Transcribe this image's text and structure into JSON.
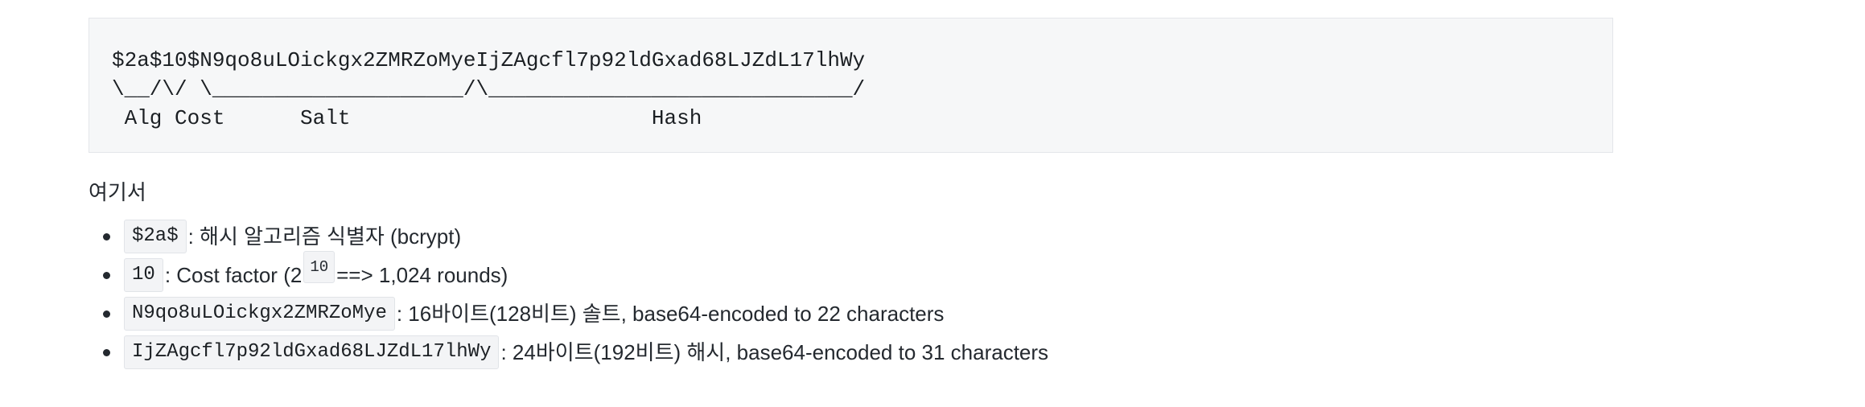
{
  "code_block": {
    "line1": "$2a$10$N9qo8uLOickgx2ZMRZoMyeIjZAgcfl7p92ldGxad68LJZdL17lhWy",
    "line2": "\\__/\\/ \\____________________/\\_____________________________/",
    "line3": " Alg Cost      Salt                        Hash"
  },
  "intro": "여기서",
  "items": [
    {
      "code": "$2a$",
      "text": ": 해시 알고리즘 식별자 (bcrypt)"
    },
    {
      "code": "10",
      "text_before": ": Cost factor (2",
      "exponent": "10",
      "text_after": "==> 1,024 rounds)"
    },
    {
      "code": "N9qo8uLOickgx2ZMRZoMye",
      "text": ": 16바이트(128비트) 솔트, base64-encoded to 22 characters"
    },
    {
      "code": "IjZAgcfl7p92ldGxad68LJZdL17lhWy",
      "text": ": 24바이트(192비트) 해시, base64-encoded to 31 characters"
    }
  ]
}
